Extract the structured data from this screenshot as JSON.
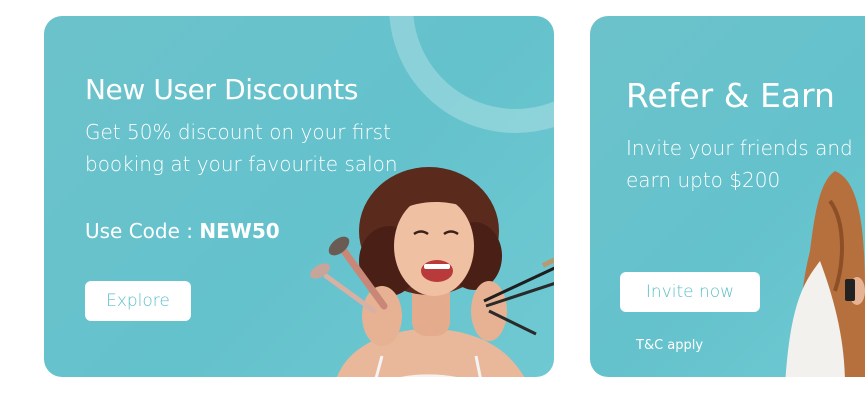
{
  "promo_cards": [
    {
      "title": "New User Discounts",
      "description": "Get 50% discount on your first booking at your favourite salon",
      "code_label": "Use Code : ",
      "code": "NEW50",
      "button_label": "Explore"
    },
    {
      "title": "Refer & Earn",
      "description_line1": "Invite your friends and",
      "description_line2": "earn upto $200",
      "button_label": "Invite now",
      "note": "T&C apply"
    }
  ],
  "colors": {
    "card_background": "#66c3cc",
    "button_text": "#5bbfc9",
    "text": "#ffffff"
  }
}
